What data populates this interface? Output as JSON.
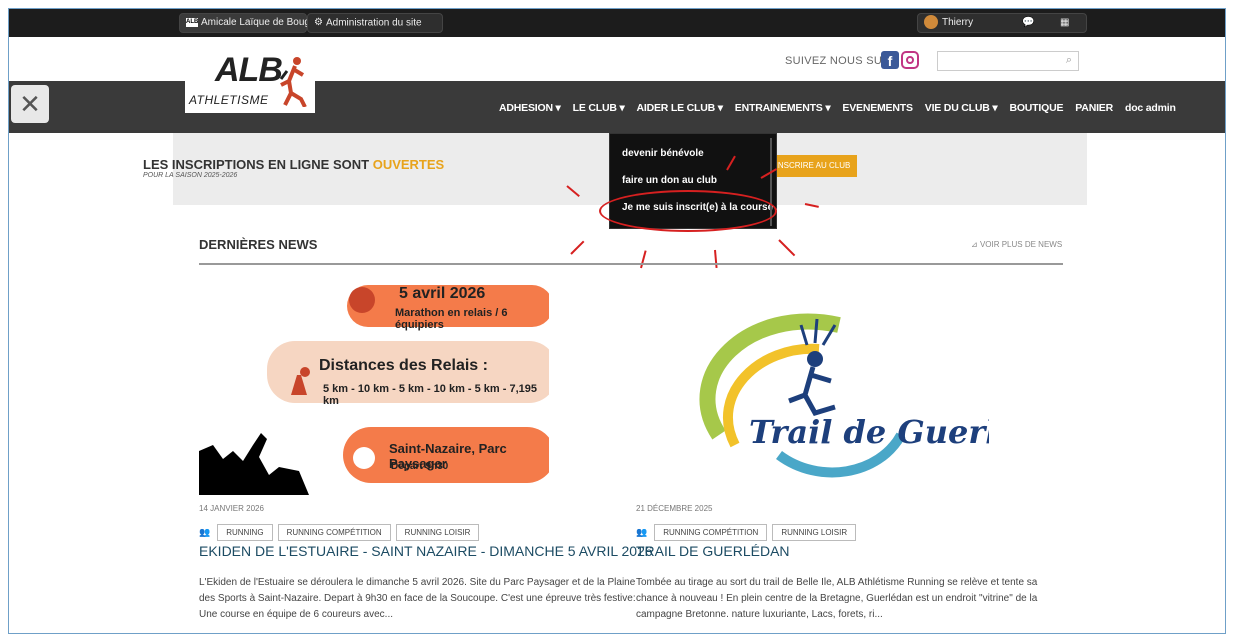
{
  "adminbar": {
    "site_label": "Amicale Laïque de Boug...",
    "site_badge": "ALB",
    "admin_label": "Administration du site",
    "user_name": "Thierry"
  },
  "header": {
    "follow_label": "SUIVEZ NOUS SUR",
    "facebook_glyph": "f",
    "search_placeholder": "",
    "logo_text": "ALB",
    "logo_sub": "ATHLETISME"
  },
  "nav": {
    "items": [
      {
        "label": "ADHESION ▾"
      },
      {
        "label": "LE CLUB ▾"
      },
      {
        "label": "AIDER LE CLUB ▾"
      },
      {
        "label": "ENTRAINEMENTS ▾"
      },
      {
        "label": "EVENEMENTS"
      },
      {
        "label": "VIE DU CLUB ▾"
      },
      {
        "label": "BOUTIQUE"
      },
      {
        "label": "PANIER"
      },
      {
        "label": "doc admin"
      }
    ]
  },
  "dropdown": {
    "items": [
      {
        "label": "devenir bénévole"
      },
      {
        "label": "faire un don au club"
      },
      {
        "label": "Je me suis inscrit(e) à la course ..."
      }
    ]
  },
  "banner": {
    "title_main": "LES INSCRIPTIONS EN LIGNE SONT ",
    "title_accent": "OUVERTES",
    "subtitle": "POUR LA SAISON 2025-2026",
    "button": "INSCRIRE AU CLUB"
  },
  "news": {
    "title": "DERNIÈRES NEWS",
    "more": "VOIR PLUS DE NEWS",
    "cards": [
      {
        "date": "14 JANVIER 2026",
        "tags": [
          "RUNNING",
          "RUNNING COMPÉTITION",
          "RUNNING LOISIR"
        ],
        "headline": "EKIDEN DE L'ESTUAIRE - SAINT NAZAIRE - DIMANCHE 5 AVRIL 2026",
        "excerpt": "L'Ekiden de l'Estuaire se déroulera le dimanche 5 avril 2026. Site du Parc Paysager et de la Plaine des Sports à Saint-Nazaire. Depart à 9h30 en face de la Soucoupe. C'est une épreuve très festive: Une course en équipe de 6 coureurs avec...",
        "poster": {
          "line1": "5 avril 2026",
          "line2": "Marathon en relais / 6 équipiers",
          "line3": "Distances des Relais :",
          "line4": "5 km - 10 km - 5 km - 10 km - 5 km - 7,195 km",
          "line5": "Saint-Nazaire, Parc Paysager",
          "line6": "Départ 9h30"
        }
      },
      {
        "date": "21 DÉCEMBRE 2025",
        "tags": [
          "RUNNING COMPÉTITION",
          "RUNNING LOISIR"
        ],
        "headline": "TRAIL DE GUERLÉDAN",
        "excerpt": "Tombée au tirage au sort du trail de Belle Ile, ALB Athlétisme Running se relève et tente sa chance à nouveau ! En plein centre de la Bretagne, Guerlédan est un endroit \"vitrine\" de la campagne Bretonne. nature luxuriante, Lacs, forets, ri...",
        "logo_text": "Trail de Guerlédan"
      }
    ]
  },
  "colors": {
    "accent": "#e8a31b",
    "nav_bg": "#3a3a3a",
    "headline": "#1c4b63",
    "highlight": "#d62020"
  }
}
